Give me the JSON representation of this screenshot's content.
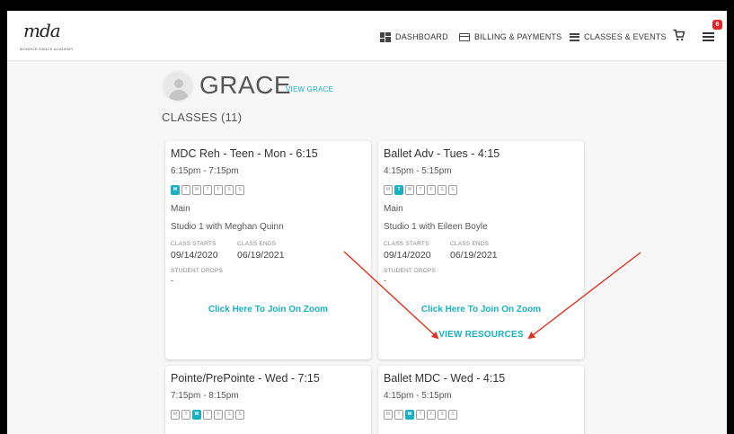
{
  "brand": {
    "logo_text": "mda",
    "logo_subtext": "MONROE DANCE ACADEMY"
  },
  "nav": {
    "dashboard": "DASHBOARD",
    "billing": "BILLING & PAYMENTS",
    "classes_events": "CLASSES & EVENTS",
    "menu_badge": "6"
  },
  "student": {
    "name": "GRACE",
    "view_link": "VIEW GRACE"
  },
  "classes_heading": "CLASSES (11)",
  "labels": {
    "class_starts": "CLASS STARTS",
    "class_ends": "CLASS ENDS",
    "student_drops": "STUDENT DROPS"
  },
  "cards": [
    {
      "title": "MDC Reh - Teen - Mon - 6:15",
      "time": "6:15pm - 7:15pm",
      "days": [
        "M",
        "T",
        "W",
        "T",
        "F",
        "S",
        "S"
      ],
      "active_day": 0,
      "location": "Main",
      "studio": "Studio 1 with Meghan Quinn",
      "class_starts": "09/14/2020",
      "class_ends": "06/19/2021",
      "student_drops": "-",
      "zoom_link": "Click Here To Join On Zoom"
    },
    {
      "title": "Ballet Adv - Tues - 4:15",
      "time": "4:15pm - 5:15pm",
      "days": [
        "M",
        "T",
        "W",
        "T",
        "F",
        "S",
        "S"
      ],
      "active_day": 1,
      "location": "Main",
      "studio": "Studio 1 with Eileen Boyle",
      "class_starts": "09/14/2020",
      "class_ends": "06/19/2021",
      "student_drops": "-",
      "zoom_link": "Click Here To Join On Zoom",
      "resources_link": "VIEW RESOURCES"
    },
    {
      "title": "Pointe/PrePointe - Wed - 7:15",
      "time": "7:15pm - 8:15pm",
      "days": [
        "M",
        "T",
        "W",
        "T",
        "F",
        "S",
        "S"
      ],
      "active_day": 2
    },
    {
      "title": "Ballet MDC - Wed - 4:15",
      "time": "4:15pm - 5:15pm",
      "days": [
        "M",
        "T",
        "W",
        "T",
        "F",
        "S",
        "S"
      ],
      "active_day": 2
    }
  ],
  "colors": {
    "accent": "#1ab0c3",
    "badge": "#e2252b",
    "annotation_arrow": "#e0301e"
  }
}
